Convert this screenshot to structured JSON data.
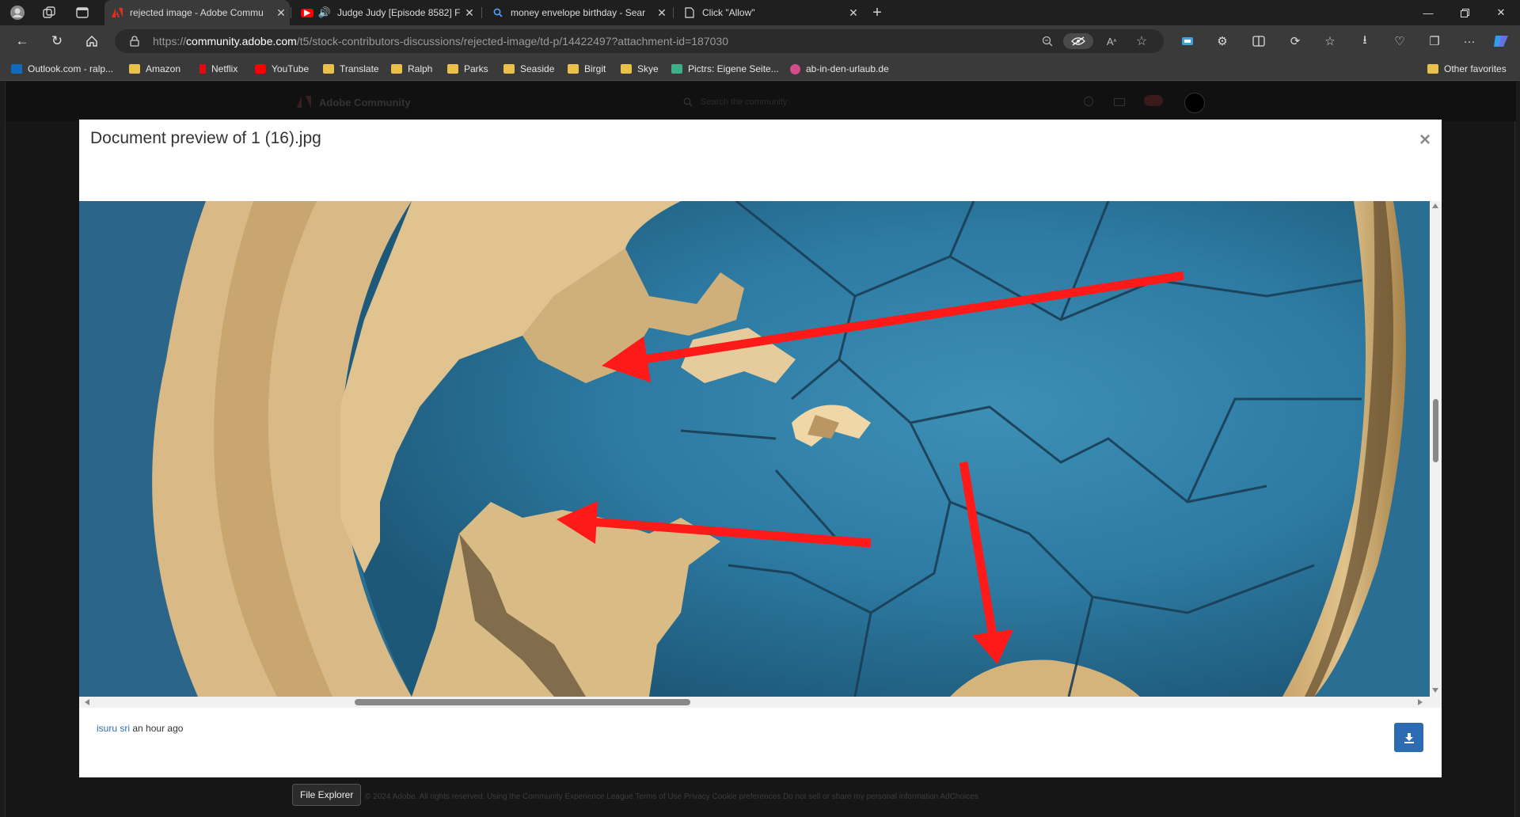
{
  "browser": {
    "tabs": [
      {
        "title": "rejected image - Adobe Commu",
        "favicon": "adobe-icon",
        "active": true
      },
      {
        "title": "Judge Judy [Episode 8582] F",
        "favicon": "youtube-icon",
        "active": false
      },
      {
        "title": "money envelope birthday - Sear",
        "favicon": "search-icon",
        "active": false
      },
      {
        "title": "Click \"Allow\"",
        "favicon": "page-icon",
        "active": false
      }
    ],
    "url_prefix": "https://",
    "url_domain": "community.adobe.com",
    "url_path": "/t5/stock-contributors-discussions/rejected-image/td-p/14422497?attachment-id=187030",
    "favorites": [
      {
        "label": "Outlook.com - ralp...",
        "icon": "outlook-icon"
      },
      {
        "label": "Amazon",
        "icon": "folder-icon"
      },
      {
        "label": "Netflix",
        "icon": "netflix-icon"
      },
      {
        "label": "YouTube",
        "icon": "youtube-icon"
      },
      {
        "label": "Translate",
        "icon": "folder-icon"
      },
      {
        "label": "Ralph",
        "icon": "folder-icon"
      },
      {
        "label": "Parks",
        "icon": "folder-icon"
      },
      {
        "label": "Seaside",
        "icon": "folder-icon"
      },
      {
        "label": "Birgit",
        "icon": "folder-icon"
      },
      {
        "label": "Skye",
        "icon": "folder-icon"
      },
      {
        "label": "Pictrs: Eigene Seite...",
        "icon": "pictrs-icon"
      },
      {
        "label": "ab-in-den-urlaub.de",
        "icon": "site-icon"
      }
    ],
    "other_favorites": "Other favorites"
  },
  "page": {
    "site_name": "Adobe Community",
    "search_placeholder": "Search the community",
    "footer_text": "© 2024 Adobe. All rights reserved.   Using the Community   Experience League   Terms of Use   Privacy   Cookie preferences   Do not sell or share my personal information   AdChoices"
  },
  "modal": {
    "title": "Document preview of 1 (16).jpg",
    "close_label": "×",
    "author": "isuru sri",
    "time": "an hour ago"
  },
  "tooltip": "File Explorer",
  "colors": {
    "accent": "#2d6bb3",
    "arrow": "#ff1a1a",
    "link": "#2c6fb5"
  }
}
